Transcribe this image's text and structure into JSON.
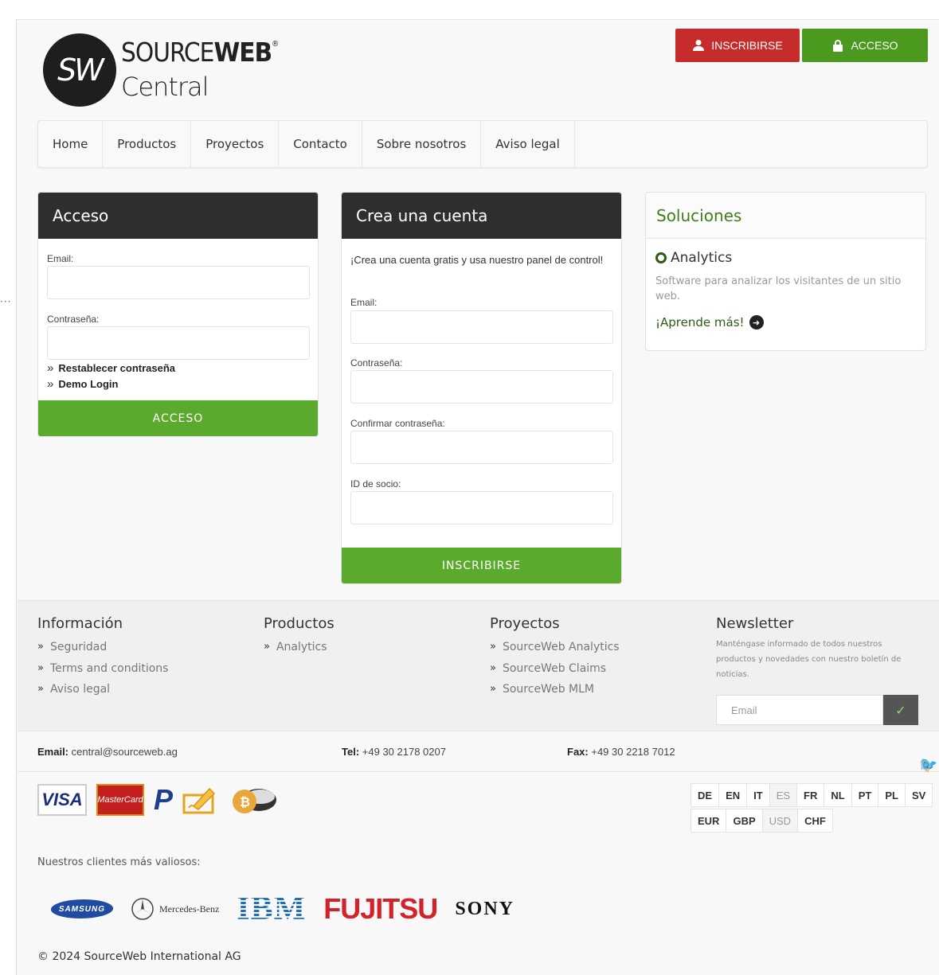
{
  "header": {
    "logo_mark": "SW",
    "logo_word_light": "SOURCE",
    "logo_word_bold": "WEB",
    "logo_reg": "®",
    "logo_sub": "Central",
    "register_label": "INSCRIBIRSE",
    "login_label": "ACCESO"
  },
  "nav": {
    "items": [
      "Home",
      "Productos",
      "Proyectos",
      "Contacto",
      "Sobre nosotros",
      "Aviso legal"
    ]
  },
  "login_panel": {
    "title": "Acceso",
    "email_label": "Email:",
    "password_label": "Contraseña:",
    "reset_link": "Restablecer contraseña",
    "demo_link": "Demo Login",
    "submit_label": "ACCESO"
  },
  "signup_panel": {
    "title": "Crea una cuenta",
    "intro": "¡Crea una cuenta gratis y usa nuestro panel de control!",
    "email_label": "Email:",
    "password_label": "Contraseña:",
    "confirm_label": "Confirmar contraseña:",
    "partner_label": "ID de socio:",
    "submit_label": "INSCRIBIRSE"
  },
  "solutions_panel": {
    "title": "Soluciones",
    "product_name": "Analytics",
    "product_desc": "Software para analizar los visitantes de un sitio web.",
    "learn_more": "¡Aprende más!"
  },
  "footer": {
    "info": {
      "title": "Información",
      "links": [
        "Seguridad",
        "Terms and conditions",
        "Aviso legal"
      ]
    },
    "products": {
      "title": "Productos",
      "links": [
        "Analytics"
      ]
    },
    "projects": {
      "title": "Proyectos",
      "links": [
        "SourceWeb Analytics",
        "SourceWeb Claims",
        "SourceWeb MLM"
      ]
    },
    "newsletter": {
      "title": "Newsletter",
      "text": "Manténgase informado de todos nuestros productos y novedades con nuestro boletín de noticias.",
      "placeholder": "Email"
    }
  },
  "contact": {
    "email_key": "Email:",
    "email_val": "central@sourceweb.ag",
    "tel_key": "Tel:",
    "tel_val": "+49 30 2178 0207",
    "fax_key": "Fax:",
    "fax_val": "+49 30 2218 7012"
  },
  "payments": {
    "visa": "VISA",
    "mastercard": "MasterCard"
  },
  "languages": [
    "DE",
    "EN",
    "IT",
    "ES",
    "FR",
    "NL",
    "PT",
    "PL",
    "SV"
  ],
  "active_language": "ES",
  "currencies": [
    "EUR",
    "GBP",
    "USD",
    "CHF"
  ],
  "active_currency": "USD",
  "clients": {
    "label": "Nuestros clientes más valiosos:",
    "samsung": "SAMSUNG",
    "mercedes": "Mercedes-Benz",
    "ibm": "IBM",
    "fujitsu": "FUJITSU",
    "sony": "SONY"
  },
  "copyright": "© 2024 SourceWeb International AG",
  "colors": {
    "red": "#c62c2c",
    "green": "#5aab2d",
    "dark": "#2e2e2e"
  }
}
